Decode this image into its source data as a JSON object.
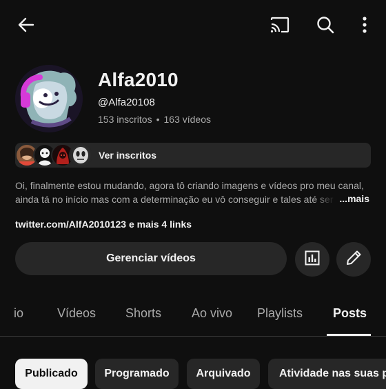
{
  "header": {
    "back_icon": "arrow-left-icon",
    "cast_icon": "cast-icon",
    "search_icon": "search-icon",
    "more_icon": "more-vertical-icon"
  },
  "channel": {
    "name": "Alfa2010",
    "handle": "@Alfa20108",
    "subscribers": "153 inscritos",
    "separator": "•",
    "videos": "163 vídeos"
  },
  "subscribers_bar": {
    "label": "Ver inscritos"
  },
  "description": {
    "line1": "Oi, finalmente estou mudando, agora tô criando imagens e vídeos pro meu canal,",
    "line2": "ainda tá no início mas com a determinação eu vô conseguir e tales até ser o",
    "more_label": "...mais"
  },
  "links": {
    "text": "twitter.com/AlfA2010123 e mais 4 links"
  },
  "actions": {
    "manage_label": "Gerenciar vídeos",
    "analytics_icon": "analytics-icon",
    "edit_icon": "edit-pencil-icon"
  },
  "tabs": [
    {
      "label": "io"
    },
    {
      "label": "Vídeos"
    },
    {
      "label": "Shorts"
    },
    {
      "label": "Ao vivo"
    },
    {
      "label": "Playlists"
    },
    {
      "label": "Posts"
    }
  ],
  "active_tab": "Posts",
  "chips": [
    {
      "label": "Publicado"
    },
    {
      "label": "Programado"
    },
    {
      "label": "Arquivado"
    },
    {
      "label": "Atividade nas suas po"
    }
  ],
  "colors": {
    "background": "#0f0f0f",
    "surface": "#272727",
    "text": "#f1f1f1",
    "muted": "#aaaaaa",
    "avatar_accent": "#d63ad8"
  }
}
